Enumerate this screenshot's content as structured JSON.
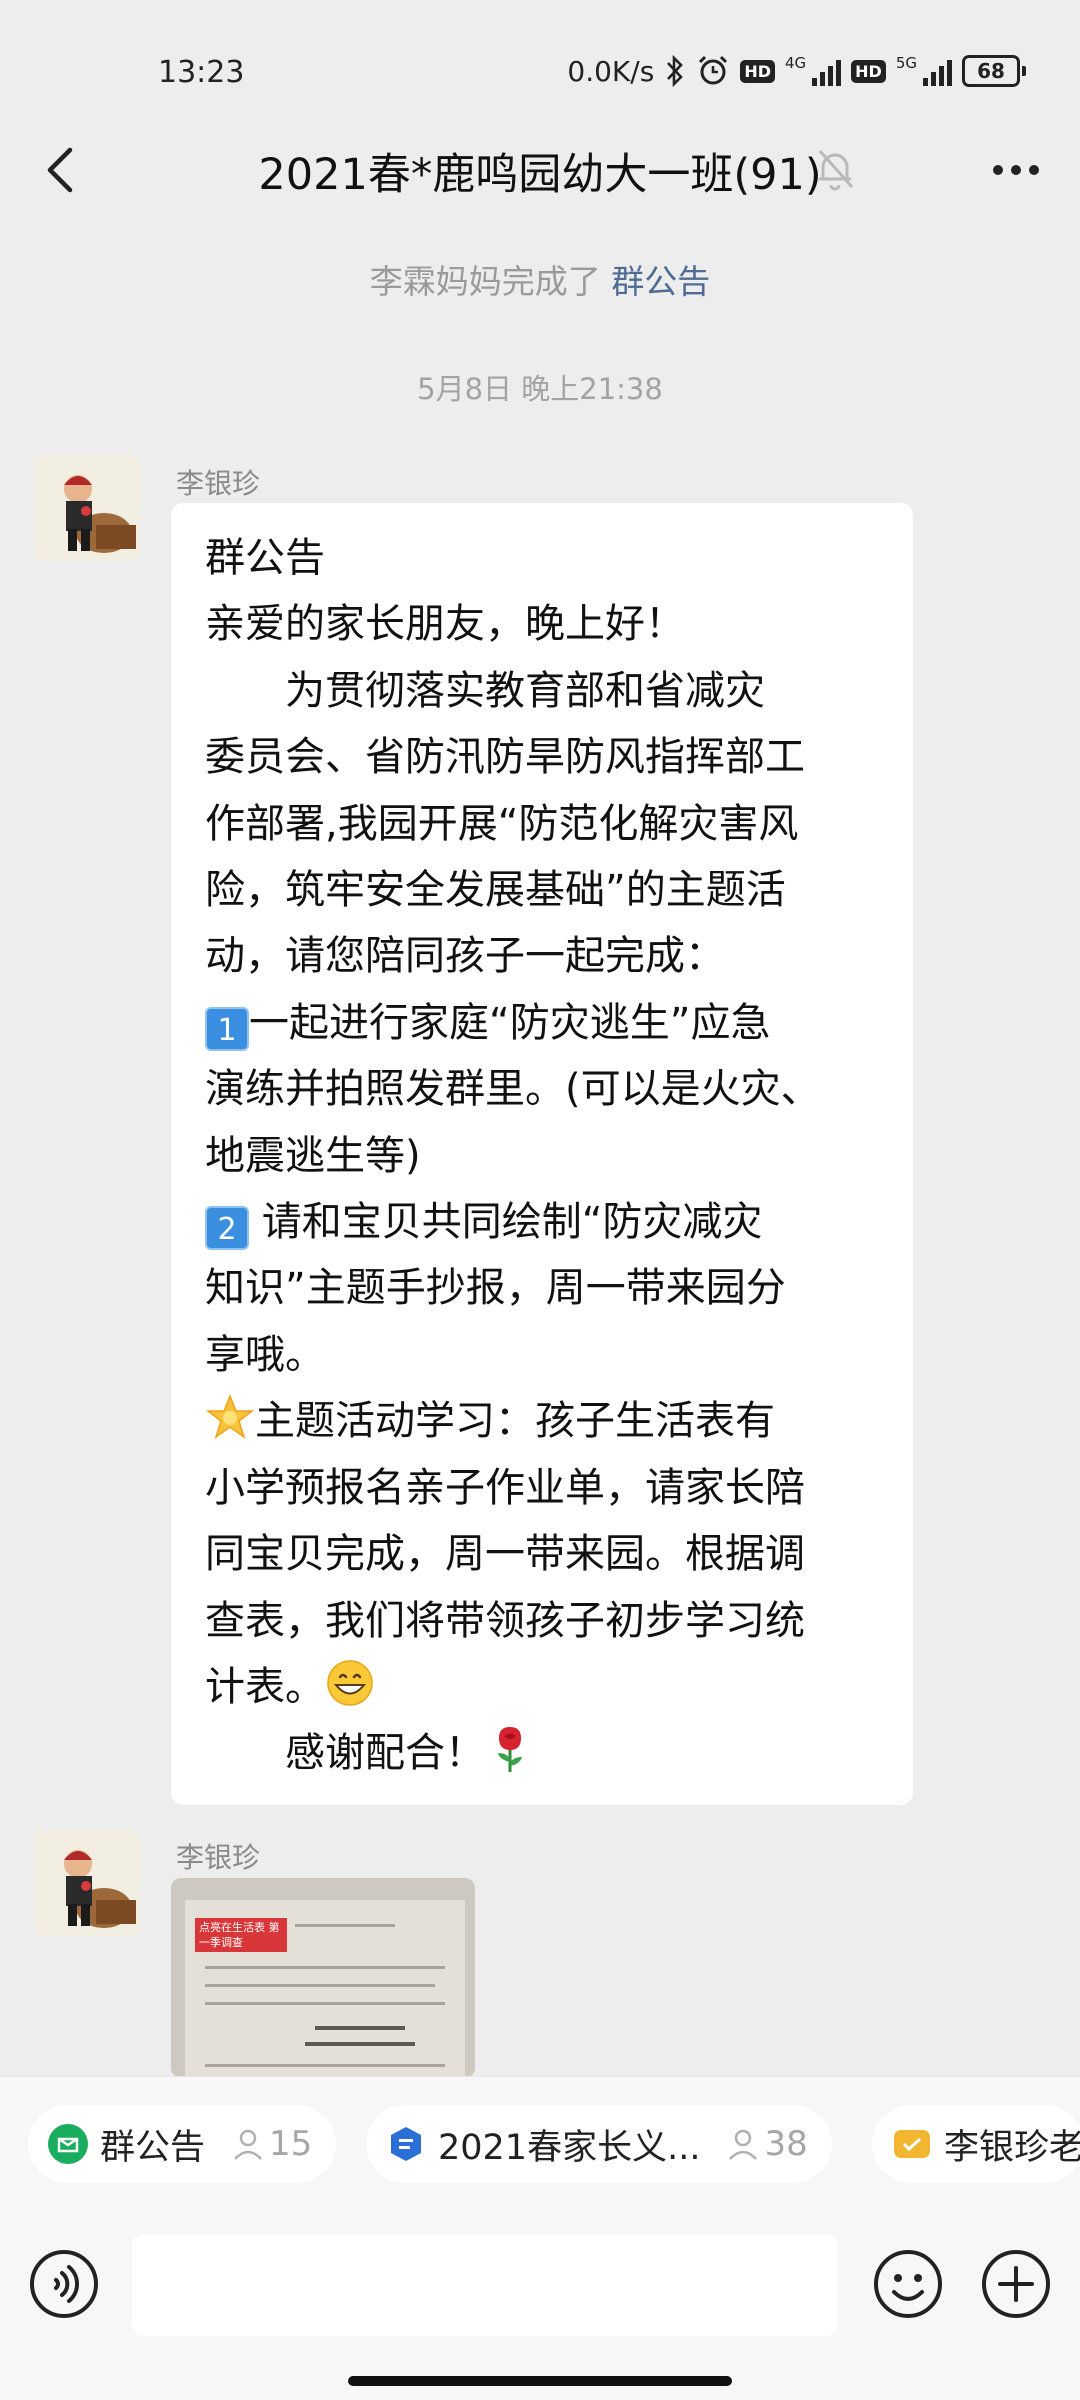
{
  "status_bar": {
    "time": "13:23",
    "net_speed": "0.0K/s",
    "network_a": "4G",
    "network_b": "5G",
    "hd_label": "HD",
    "battery": "68"
  },
  "header": {
    "title": "2021春*鹿鸣园幼大一班(91)"
  },
  "system_notice": {
    "actor": "李霖妈妈完成了",
    "link": "群公告"
  },
  "time_divider": "5月8日 晚上21:38",
  "messages": [
    {
      "sender": "李银珍",
      "lines": {
        "l1": "群公告",
        "l2": "亲爱的家长朋友，晚上好！",
        "l3": "　　为贯彻落实教育部和省减灾",
        "l4": "委员会、省防汛防旱防风指挥部工",
        "l5": "作部署,我园开展“防范化解灾害风",
        "l6": "险，筑牢安全发展基础”的主题活",
        "l7": "动，请您陪同孩子一起完成：",
        "b1": "1",
        "l8": "一起进行家庭“防灾逃生”应急",
        "l9": "演练并拍照发群里。(可以是火灾、",
        "l10": "地震逃生等)",
        "b2": "2",
        "l11": " 请和宝贝共同绘制“防灾减灾",
        "l12": "知识”主题手抄报，周一带来园分",
        "l13": "享哦。",
        "l14": "主题活动学习：孩子生活表有",
        "l15": "小学预报名亲子作业单，请家长陪",
        "l16": "同宝贝完成，周一带来园。根据调",
        "l17": "查表，我们将带领孩子初步学习统",
        "l18": "计表。",
        "l19": "　　感谢配合！"
      }
    },
    {
      "sender": "李银珍",
      "photo_tag": "点亮在生活表 第一季调查"
    }
  ],
  "quick_bar": [
    {
      "label": "群公告",
      "count": "15"
    },
    {
      "label": "2021春家长义...",
      "count": "38"
    },
    {
      "label": "李银珍老"
    }
  ],
  "input": {
    "placeholder": ""
  },
  "colors": {
    "link": "#4f6c94",
    "background": "#ededed",
    "bubble": "#ffffff",
    "announcement_icon": "#1aad5d",
    "doc_icon": "#2a6fd6",
    "folder_icon": "#f2b630"
  }
}
